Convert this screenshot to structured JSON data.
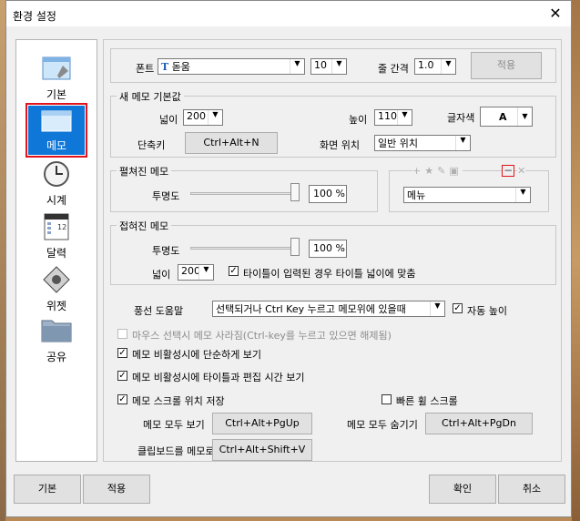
{
  "window": {
    "title": "환경 설정"
  },
  "sidebar": {
    "items": [
      {
        "label": "기본",
        "icon": "window-icon"
      },
      {
        "label": "메모",
        "icon": "memo-window-icon",
        "selected": true
      },
      {
        "label": "시계",
        "icon": "clock-icon"
      },
      {
        "label": "달력",
        "icon": "calendar-icon",
        "badge": "12"
      },
      {
        "label": "위젯",
        "icon": "widget-icon"
      },
      {
        "label": "공유",
        "icon": "folder-icon"
      }
    ]
  },
  "font_row": {
    "font_label": "폰트",
    "font_value": "돋움",
    "font_icon_text": "T",
    "size_value": "10",
    "line_spacing_label": "줄 간격",
    "line_spacing_value": "1.0",
    "apply_label": "적용"
  },
  "new_memo": {
    "group_label": "새 메모 기본값",
    "width_label": "넓이",
    "width_value": "200",
    "height_label": "높이",
    "height_value": "110",
    "text_color_label": "글자색",
    "text_color_value": "A",
    "shortcut_label": "단축키",
    "shortcut_value": "Ctrl+Alt+N",
    "screen_pos_label": "화면 위치",
    "screen_pos_value": "일반 위치"
  },
  "expanded": {
    "group_label": "펼쳐진 메모",
    "opacity_label": "투명도",
    "opacity_value": "100 %",
    "opacity_level": 1.0,
    "menu_value": "메뉴"
  },
  "collapsed": {
    "group_label": "접혀진 메모",
    "opacity_label": "투명도",
    "opacity_value": "100 %",
    "opacity_level": 1.0,
    "width_label": "넓이",
    "width_value": "200",
    "title_width_label": "타이틀이 입력된 경우 타이틀 넓이에 맞춤",
    "title_width_checked": true
  },
  "balloon": {
    "label": "풍선 도움말",
    "value": "선택되거나 Ctrl Key 누르고  메모위에 있을때",
    "auto_height_label": "자동 높이",
    "auto_height_checked": true
  },
  "options": {
    "mouse_hide": "마우스 선택시 메모 사라짐(Ctrl-key를 누르고 있으면 해제됨)",
    "simple_view": "메모 비활성시에 단순하게 보기",
    "title_time_view": "메모 비활성시에 타이틀과 편집 시간 보기",
    "scroll_save": "메모 스크롤 위치 저장",
    "fast_wheel": "빠른 휠 스크롤"
  },
  "shortcuts": {
    "show_all_label": "메모 모두 보기",
    "show_all_value": "Ctrl+Alt+PgUp",
    "hide_all_label": "메모 모두 숨기기",
    "hide_all_value": "Ctrl+Alt+PgDn",
    "clip_label": "클립보드를 메모로",
    "clip_value": "Ctrl+Alt+Shift+V"
  },
  "footer": {
    "default_label": "기본",
    "apply_label": "적용",
    "ok_label": "확인",
    "cancel_label": "취소"
  },
  "colors": {
    "selected_bg": "#0f77d8",
    "selected_outline": "#e0141a"
  }
}
